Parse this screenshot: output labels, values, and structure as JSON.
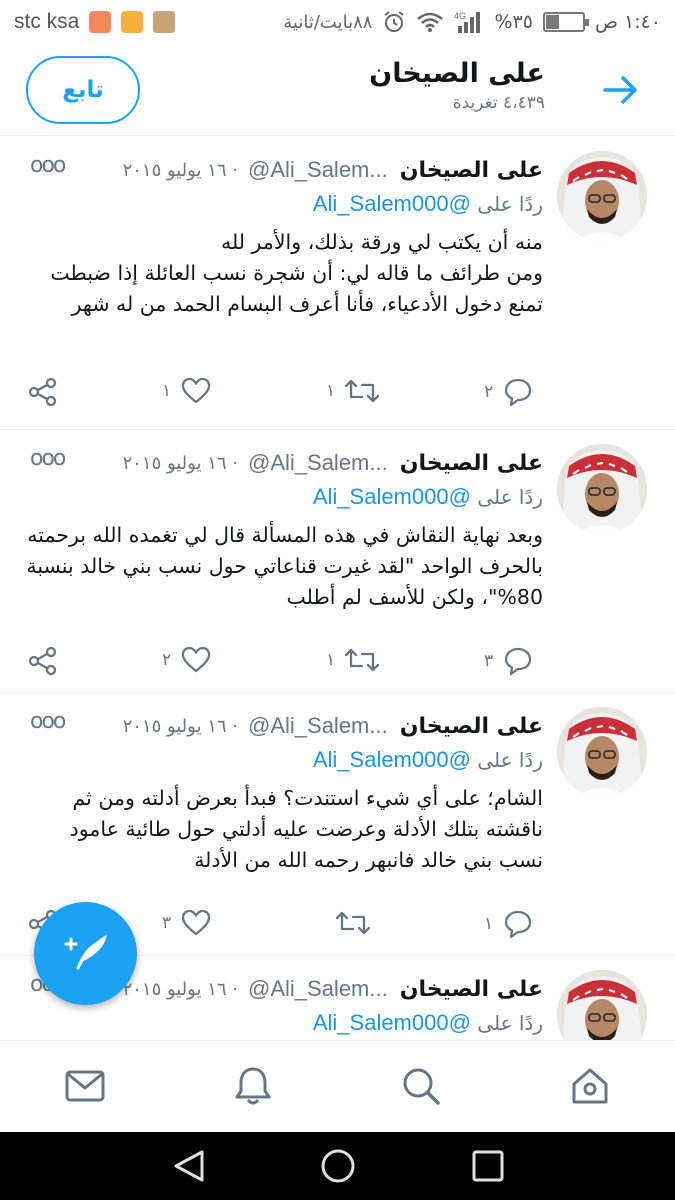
{
  "status_bar": {
    "carrier": "stc ksa",
    "speed": "٨٨بايت/ثانية",
    "network": "4G",
    "battery": "%٣٥",
    "battery_level": 0.35,
    "time": "١:٤٠ ص"
  },
  "header": {
    "name": "على الصيخان",
    "tweet_count": "٤،٤٣٩ تغريدة",
    "follow_label": "تابع",
    "back_icon": "arrow-right-icon"
  },
  "tweets": [
    {
      "name": "على الصيخان",
      "handle": "@Ali_Salem...",
      "date": "· ١٦ يوليو ٢٠١٥",
      "reply_prefix": "ردًا على",
      "reply_to": "@Ali_Salem000",
      "text": "منه أن يكتب لي ورقة بذلك، والأمر لله\nومن طرائف ما قاله لي: أن شجرة نسب العائلة إذا ضبطت تمنع دخول الأدعياء، فأنا أعرف البسام الحمد من له شهر",
      "replies": "٢",
      "retweets": "١",
      "likes": "١"
    },
    {
      "name": "على الصيخان",
      "handle": "@Ali_Salem...",
      "date": "· ١٦ يوليو ٢٠١٥",
      "reply_prefix": "ردًا على",
      "reply_to": "@Ali_Salem000",
      "text": "وبعد نهاية النقاش في هذه المسألة قال لي تغمده الله برحمته بالحرف الواحد \"لقد غيرت قناعاتي حول نسب بني خالد بنسبة 80%\"، ولكن للأسف لم أطلب",
      "replies": "٣",
      "retweets": "١",
      "likes": "٢"
    },
    {
      "name": "على الصيخان",
      "handle": "@Ali_Salem...",
      "date": "· ١٦ يوليو ٢٠١٥",
      "reply_prefix": "ردًا على",
      "reply_to": "@Ali_Salem000",
      "text": "الشام؛ على أي شيء استندت؟ فبدأ بعرض أدلته ومن ثم ناقشته بتلك الأدلة وعرضت عليه أدلتي حول طائية عامود نسب بني خالد فانبهر رحمه الله من الأدلة",
      "replies": "١",
      "retweets": "",
      "likes": "٣"
    },
    {
      "name": "على الصيخان",
      "handle": "@Ali_Salem...",
      "date": "· ١٦ يوليو ٢٠١٥",
      "reply_prefix": "ردًا على",
      "reply_to": "@Ali_Salem000",
      "text": "",
      "replies": "",
      "retweets": "",
      "likes": ""
    }
  ],
  "fab": {
    "icon": "compose-tweet-icon"
  },
  "bottom_nav": [
    "mail-icon",
    "bell-icon",
    "search-icon",
    "home-icon"
  ],
  "android_nav": [
    "back-icon",
    "home-circle-icon",
    "recents-icon"
  ],
  "colors": {
    "accent": "#1da1f2",
    "text": "#14171a",
    "secondary": "#657786",
    "link": "#1b95e0"
  }
}
